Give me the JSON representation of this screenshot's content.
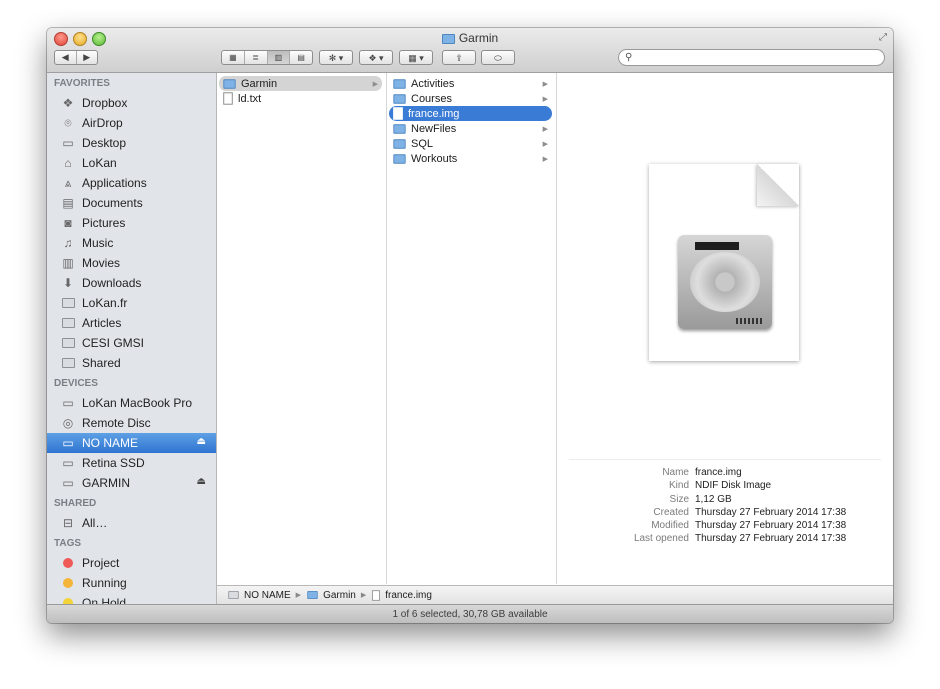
{
  "window": {
    "title": "Garmin"
  },
  "toolbar": {
    "back": "◀",
    "forward": "▶",
    "views": [
      "▦",
      "≣",
      "▥",
      "▤"
    ],
    "action": "✻ ▾",
    "dropbox": "❖ ▾",
    "arrange": "▦ ▾",
    "share": "⇪",
    "tags": "⬭",
    "search_placeholder": ""
  },
  "sidebar": {
    "favorites_header": "FAVORITES",
    "favorites": [
      {
        "label": "Dropbox",
        "icon": "dropbox-icon"
      },
      {
        "label": "AirDrop",
        "icon": "airdrop-icon"
      },
      {
        "label": "Desktop",
        "icon": "desktop-icon"
      },
      {
        "label": "LoKan",
        "icon": "home-icon"
      },
      {
        "label": "Applications",
        "icon": "applications-icon"
      },
      {
        "label": "Documents",
        "icon": "documents-icon"
      },
      {
        "label": "Pictures",
        "icon": "pictures-icon"
      },
      {
        "label": "Music",
        "icon": "music-icon"
      },
      {
        "label": "Movies",
        "icon": "movies-icon"
      },
      {
        "label": "Downloads",
        "icon": "downloads-icon"
      },
      {
        "label": "LoKan.fr",
        "icon": "folder-icon"
      },
      {
        "label": "Articles",
        "icon": "folder-icon"
      },
      {
        "label": "CESI GMSI",
        "icon": "folder-icon"
      },
      {
        "label": "Shared",
        "icon": "folder-icon"
      }
    ],
    "devices_header": "DEVICES",
    "devices": [
      {
        "label": "LoKan MacBook Pro",
        "icon": "laptop-icon"
      },
      {
        "label": "Remote Disc",
        "icon": "disc-icon"
      },
      {
        "label": "NO NAME",
        "icon": "drive-icon",
        "selected": true,
        "eject": true
      },
      {
        "label": "Retina SSD",
        "icon": "drive-icon"
      },
      {
        "label": "GARMIN",
        "icon": "drive-icon",
        "eject": true
      }
    ],
    "shared_header": "SHARED",
    "shared": [
      {
        "label": "All…",
        "icon": "network-icon"
      }
    ],
    "tags_header": "TAGS",
    "tags": [
      {
        "label": "Project",
        "color": "#ef5a58"
      },
      {
        "label": "Running",
        "color": "#f5b53a"
      },
      {
        "label": "On Hold",
        "color": "#f3d33a"
      }
    ],
    "eject_symbol": "⏏"
  },
  "columns": {
    "col1": [
      {
        "label": "Garmin",
        "type": "folder",
        "state": "dim",
        "arrow": true
      },
      {
        "label": "ld.txt",
        "type": "file"
      }
    ],
    "col2": [
      {
        "label": "Activities",
        "type": "folder",
        "arrow": true
      },
      {
        "label": "Courses",
        "type": "folder",
        "arrow": true
      },
      {
        "label": "france.img",
        "type": "file",
        "state": "selected"
      },
      {
        "label": "NewFiles",
        "type": "folder",
        "arrow": true
      },
      {
        "label": "SQL",
        "type": "folder",
        "arrow": true
      },
      {
        "label": "Workouts",
        "type": "folder",
        "arrow": true
      }
    ],
    "arrow_symbol": "▶"
  },
  "preview": {
    "info": [
      {
        "key": "Name",
        "value": "france.img"
      },
      {
        "key": "Kind",
        "value": "NDIF Disk Image"
      },
      {
        "key": "Size",
        "value": "1,12 GB"
      },
      {
        "key": "Created",
        "value": "Thursday 27 February 2014 17:38"
      },
      {
        "key": "Modified",
        "value": "Thursday 27 February 2014 17:38"
      },
      {
        "key": "Last opened",
        "value": "Thursday 27 February 2014 17:38"
      }
    ]
  },
  "pathbar": {
    "segments": [
      {
        "label": "NO NAME",
        "type": "drive"
      },
      {
        "label": "Garmin",
        "type": "folder"
      },
      {
        "label": "france.img",
        "type": "file"
      }
    ],
    "separator": "▶"
  },
  "statusbar": {
    "text": "1 of 6 selected, 30,78 GB available"
  },
  "colors": {
    "selection": "#3a7bd5",
    "sidebar_bg": "#e1e5ea"
  }
}
